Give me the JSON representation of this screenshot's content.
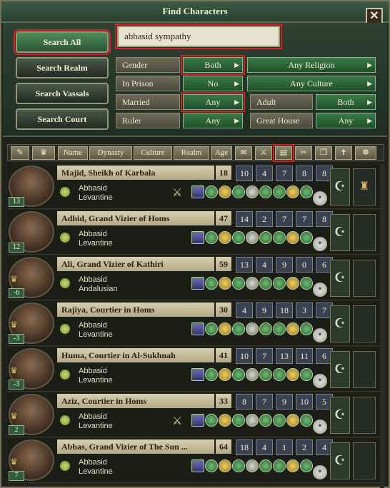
{
  "window": {
    "title": "Find Characters",
    "close_glyph": "✕"
  },
  "search": {
    "value": "abbasid sympathy"
  },
  "scope_buttons": [
    "Search All",
    "Search Realm",
    "Search Vassals",
    "Search Court"
  ],
  "filters": {
    "gender": {
      "label": "Gender",
      "value": "Both"
    },
    "in_prison": {
      "label": "In Prison",
      "value": "No"
    },
    "married": {
      "label": "Married",
      "value": "Any"
    },
    "ruler": {
      "label": "Ruler",
      "value": "Any"
    },
    "religion": {
      "value": "Any Religion"
    },
    "culture": {
      "value": "Any Culture"
    },
    "adult": {
      "label": "Adult",
      "value": "Both"
    },
    "great_house": {
      "label": "Great House",
      "value": "Any"
    }
  },
  "columns": [
    "Name",
    "Dynasty",
    "Culture",
    "Realm",
    "Age"
  ],
  "characters": [
    {
      "name": "Majid, Sheikh of Karbala",
      "age": "18",
      "badge": "13",
      "dynasty": "Abbasid",
      "culture": "Levantine",
      "stats": [
        "10",
        "4",
        "7",
        "8",
        "8"
      ],
      "crown": false,
      "swords": true
    },
    {
      "name": "Adhid, Grand Vizier of Homs",
      "age": "47",
      "badge": "12",
      "dynasty": "Abbasid",
      "culture": "Levantine",
      "stats": [
        "14",
        "2",
        "7",
        "7",
        "8"
      ],
      "crown": false,
      "swords": false
    },
    {
      "name": "Ali, Grand Vizier of Kathiri",
      "age": "59",
      "badge": "-6",
      "dynasty": "Abbasid",
      "culture": "Andalusian",
      "stats": [
        "13",
        "4",
        "9",
        "0",
        "6"
      ],
      "crown": true,
      "swords": false
    },
    {
      "name": "Rajiya, Courtier in Homs",
      "age": "30",
      "badge": "-3",
      "dynasty": "Abbasid",
      "culture": "Levantine",
      "stats": [
        "4",
        "9",
        "18",
        "3",
        "7"
      ],
      "crown": true,
      "swords": false
    },
    {
      "name": "Huma, Courtier in Al-Sukhnah",
      "age": "41",
      "badge": "-3",
      "dynasty": "Abbasid",
      "culture": "Levantine",
      "stats": [
        "10",
        "7",
        "13",
        "11",
        "6"
      ],
      "crown": true,
      "swords": false
    },
    {
      "name": "Aziz, Courtier in Homs",
      "age": "33",
      "badge": "2",
      "dynasty": "Abbasid",
      "culture": "Levantine",
      "stats": [
        "8",
        "7",
        "9",
        "10",
        "5"
      ],
      "crown": true,
      "swords": true
    },
    {
      "name": "Abbas, Grand Vizier of The Sun ...",
      "age": "64",
      "badge": "7",
      "dynasty": "Abbasid",
      "culture": "Levantine",
      "stats": [
        "18",
        "4",
        "1",
        "2",
        "4"
      ],
      "crown": true,
      "swords": false
    }
  ],
  "colors": {
    "accent_green": "#2f5d39",
    "highlight_red": "#d42020",
    "stat_bg": "#3a4150"
  }
}
